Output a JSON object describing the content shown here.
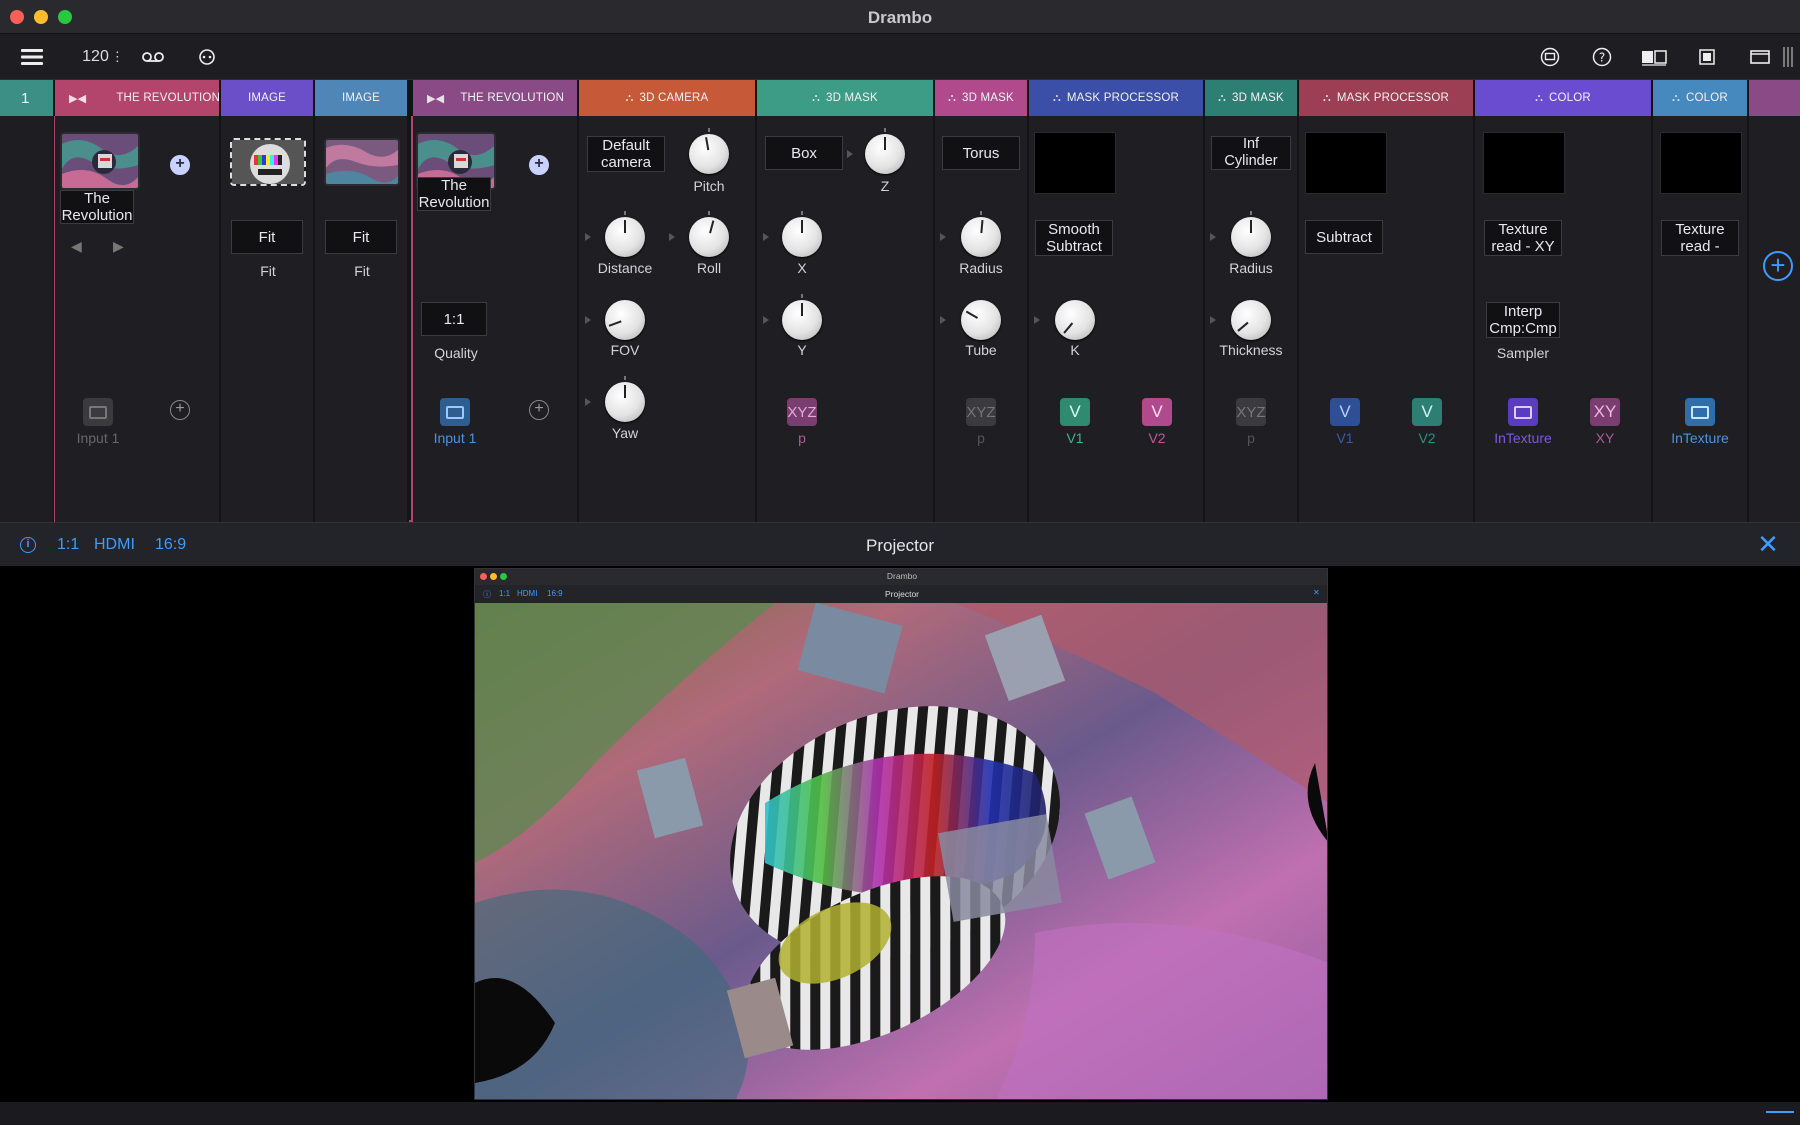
{
  "window": {
    "title": "Drambo"
  },
  "toolbar": {
    "tempo": "120",
    "tempo_suffix": "⋮"
  },
  "track": {
    "number": "1"
  },
  "devices": {
    "revolution1": {
      "header": "THE REVOLUTION",
      "name_line1": "The",
      "name_line2": "Revolution",
      "input_label": "Input 1"
    },
    "image1": {
      "header": "IMAGE",
      "fit_box": "Fit",
      "fit_label": "Fit"
    },
    "image2": {
      "header": "IMAGE",
      "fit_box": "Fit",
      "fit_label": "Fit"
    },
    "revolution2": {
      "header": "THE REVOLUTION",
      "name_line1": "The",
      "name_line2": "Revolution",
      "quality_value": "1:1",
      "quality_label": "Quality",
      "input_label": "Input 1"
    },
    "camera": {
      "header": "3D CAMERA",
      "cam_line1": "Default",
      "cam_line2": "camera",
      "pitch": "Pitch",
      "distance": "Distance",
      "roll": "Roll",
      "fov": "FOV",
      "yaw": "Yaw"
    },
    "mask1": {
      "header": "3D MASK",
      "shape": "Box",
      "z": "Z",
      "x": "X",
      "y": "Y",
      "port": "XYZ",
      "port_label": "p"
    },
    "mask2": {
      "header": "3D MASK",
      "shape": "Torus",
      "radius": "Radius",
      "tube": "Tube",
      "port": "XYZ",
      "port_label": "p"
    },
    "proc1": {
      "header": "MASK PROCESSOR",
      "op_line1": "Smooth",
      "op_line2": "Subtract",
      "k": "K",
      "v1": "V",
      "v1_label": "V1",
      "v2": "V",
      "v2_label": "V2"
    },
    "mask3": {
      "header": "3D MASK",
      "shape": "Inf Cylinder",
      "radius": "Radius",
      "thickness": "Thickness",
      "port": "XYZ",
      "port_label": "p"
    },
    "proc2": {
      "header": "MASK PROCESSOR",
      "op": "Subtract",
      "v1": "V",
      "v1_label": "V1",
      "v2": "V",
      "v2_label": "V2"
    },
    "color1": {
      "header": "COLOR",
      "mode_line1": "Texture",
      "mode_line2": "read - XY",
      "interp_line1": "Interp",
      "interp_line2": "Cmp:Cmp",
      "sampler": "Sampler",
      "in_label": "InTexture",
      "xy": "XY",
      "xy_label": "XY"
    },
    "color2": {
      "header": "COLOR",
      "mode_line1": "Texture",
      "mode_line2": "read -",
      "in_label": "InTexture"
    }
  },
  "projector": {
    "title": "Projector",
    "scale": "1:1",
    "output": "HDMI",
    "aspect": "16:9",
    "close": "✕"
  },
  "mini": {
    "title": "Drambo",
    "projector_title": "Projector",
    "scale": "1:1",
    "output": "HDMI",
    "aspect": "16:9",
    "close": "✕"
  },
  "colors": {
    "revolution": "#b3456c",
    "image1": "#6a4fc9",
    "image2": "#4e86b8",
    "revolution2": "#8a4a86",
    "camera": "#c65a38",
    "mask_green": "#3c9c86",
    "mask_pink": "#b04a8c",
    "processor": "#3b4fa8",
    "mask_teal": "#2e7f73",
    "processor2": "#9c3e54",
    "color1": "#6a4cd0",
    "color2": "#4689bf",
    "accent": "#3e9cff"
  }
}
